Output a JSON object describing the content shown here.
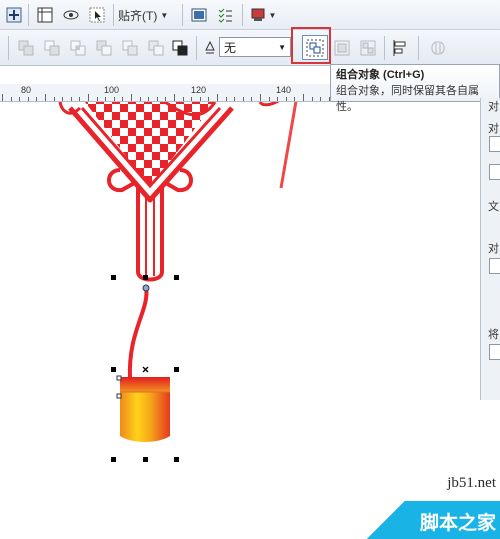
{
  "toolbar_top": {
    "paste_label": "贴齐(T)",
    "buttons": [
      "view-icon",
      "frame-icon",
      "eye-icon",
      "cursor-icon",
      "image-icon",
      "list-icon",
      "export-icon"
    ]
  },
  "toolbar_props": {
    "outline_value": "无",
    "group_button_icon": "group-objects-icon"
  },
  "ruler": {
    "labels": [
      "80",
      "100",
      "120",
      "140"
    ]
  },
  "tooltip": {
    "title": "组合对象 (Ctrl+G)",
    "description": "组合对象，同时保留其各自属性。"
  },
  "panel": {
    "labels": [
      "对",
      "对",
      "文",
      "对",
      "将"
    ]
  },
  "watermark": {
    "url": "jb51.net",
    "text": "脚本之家"
  },
  "colors": {
    "knot_red": "#e8242a",
    "highlight_box": "#d9333b",
    "arrow": "#f04848",
    "watermark_blue": "#19b3e6"
  }
}
